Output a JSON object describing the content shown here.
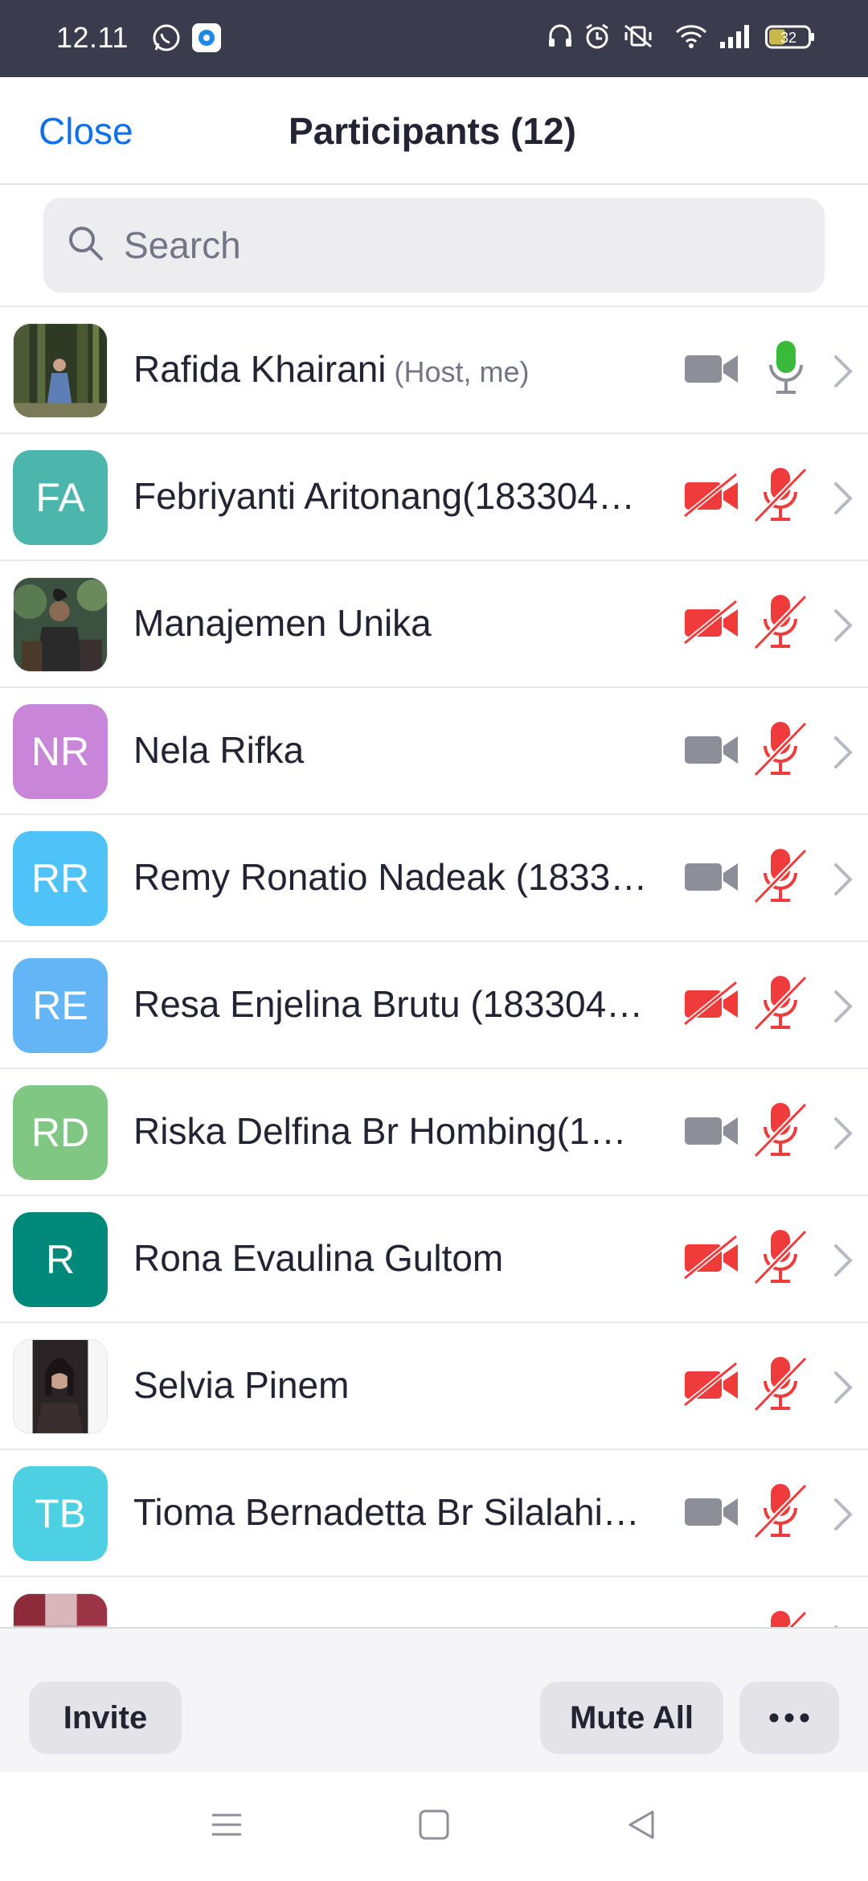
{
  "status_bar": {
    "time": "12.11",
    "battery": "32",
    "icons": [
      "whatsapp-icon",
      "app-notification-icon",
      "headphones-icon",
      "alarm-icon",
      "vibrate-off-icon",
      "wifi-icon",
      "signal-icon",
      "battery-icon"
    ]
  },
  "header": {
    "close_label": "Close",
    "title": "Participants (12)"
  },
  "search": {
    "placeholder": "Search"
  },
  "colors": {
    "accent": "#0e71eb",
    "muted_red": "#ef3b3b",
    "mic_active_green": "#3bb93a",
    "icon_gray": "#8e8e98"
  },
  "participants": [
    {
      "name": "Rafida Khairani",
      "role": "(Host, me)",
      "avatar_type": "photo",
      "video": "on",
      "audio": "active"
    },
    {
      "name": "Febriyanti Aritonang(183304…",
      "initials": "FA",
      "avatar_color": "#4db6ac",
      "video": "off",
      "audio": "muted"
    },
    {
      "name": "Manajemen Unika",
      "avatar_type": "photo",
      "video": "off",
      "audio": "muted"
    },
    {
      "name": "Nela Rifka",
      "initials": "NR",
      "avatar_color": "#c986d9",
      "video": "on",
      "audio": "muted"
    },
    {
      "name": "Remy Ronatio Nadeak (1833…",
      "initials": "RR",
      "avatar_color": "#4fc3f7",
      "video": "on",
      "audio": "muted"
    },
    {
      "name": "Resa Enjelina Brutu (183304…",
      "initials": "RE",
      "avatar_color": "#64b5f6",
      "video": "off",
      "audio": "muted"
    },
    {
      "name": "Riska Delfina Br Hombing(1…",
      "initials": "RD",
      "avatar_color": "#81c784",
      "video": "on",
      "audio": "muted"
    },
    {
      "name": "Rona Evaulina Gultom",
      "initials": "R",
      "avatar_color": "#00897b",
      "video": "off",
      "audio": "muted"
    },
    {
      "name": "Selvia Pinem",
      "avatar_type": "photo",
      "video": "off",
      "audio": "muted"
    },
    {
      "name": "Tioma Bernadetta Br Silalahi…",
      "initials": "TB",
      "avatar_color": "#4dd0e1",
      "video": "on",
      "audio": "muted"
    }
  ],
  "actions": {
    "invite_label": "Invite",
    "mute_all_label": "Mute All",
    "more_label": "···"
  },
  "nav": [
    "menu-icon",
    "home-icon",
    "back-icon"
  ]
}
